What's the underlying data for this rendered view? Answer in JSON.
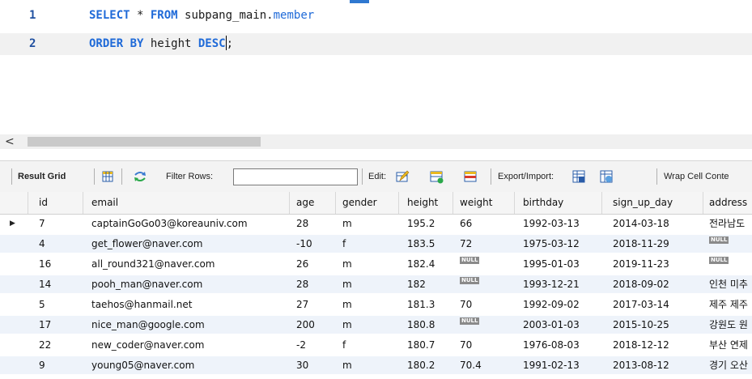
{
  "editor": {
    "lines": [
      {
        "num": "1",
        "kw1": "SELECT",
        "mid1": " * ",
        "kw2": "FROM",
        "mid2": " subpang_main.",
        "tail": "member"
      },
      {
        "num": "2",
        "kw1": "ORDER BY",
        "mid1": " height ",
        "kw2": "DESC",
        "tail": ";"
      }
    ]
  },
  "scrollbar": {
    "left_arrow": "<"
  },
  "toolbar": {
    "result_grid": "Result Grid",
    "filter_rows": "Filter Rows:",
    "filter_value": "",
    "edit": "Edit:",
    "export_import": "Export/Import:",
    "wrap": "Wrap Cell Conte"
  },
  "grid": {
    "headers": [
      "id",
      "email",
      "age",
      "gender",
      "height",
      "weight",
      "birthday",
      "sign_up_day",
      "address"
    ],
    "null_label": "NULL",
    "current_row_marker": "▶",
    "rows": [
      [
        "7",
        "captainGoGo03@koreauniv.com",
        "28",
        "m",
        "195.2",
        "66",
        "1992-03-13",
        "2014-03-18",
        "전라남도"
      ],
      [
        "4",
        "get_flower@naver.com",
        "-10",
        "f",
        "183.5",
        "72",
        "1975-03-12",
        "2018-11-29",
        null
      ],
      [
        "16",
        "all_round321@naver.com",
        "26",
        "m",
        "182.4",
        null,
        "1995-01-03",
        "2019-11-23",
        null
      ],
      [
        "14",
        "pooh_man@naver.com",
        "28",
        "m",
        "182",
        null,
        "1993-12-21",
        "2018-09-02",
        "인천 미추"
      ],
      [
        "5",
        "taehos@hanmail.net",
        "27",
        "m",
        "181.3",
        "70",
        "1992-09-02",
        "2017-03-14",
        "제주 제주"
      ],
      [
        "17",
        "nice_man@google.com",
        "200",
        "m",
        "180.8",
        null,
        "2003-01-03",
        "2015-10-25",
        "강원도 원"
      ],
      [
        "22",
        "new_coder@naver.com",
        "-2",
        "f",
        "180.7",
        "70",
        "1976-08-03",
        "2018-12-12",
        "부산 연제"
      ],
      [
        "9",
        "young05@naver.com",
        "30",
        "m",
        "180.2",
        "70.4",
        "1991-02-13",
        "2013-08-12",
        "경기 오산"
      ]
    ]
  },
  "colors": {
    "keyword": "#1f6ad8",
    "alt_row": "#eef3fa",
    "null_badge": "#8a8a8a"
  }
}
